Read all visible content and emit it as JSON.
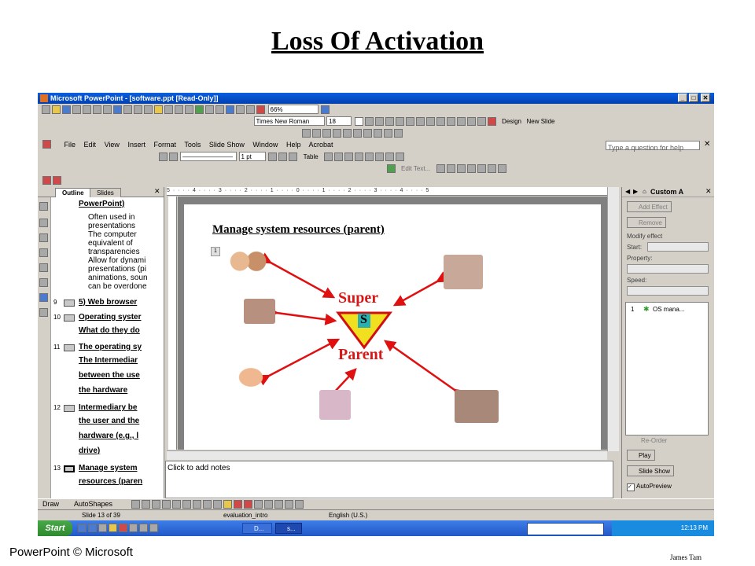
{
  "slide_title": "Loss Of Activation",
  "window": {
    "title": "Microsoft PowerPoint - [software.ppt [Read-Only]]"
  },
  "toolbar": {
    "zoom": "66%",
    "font": "Times New Roman",
    "font_size": "18",
    "design": "Design",
    "new_slide": "New Slide"
  },
  "menu": [
    "File",
    "Edit",
    "View",
    "Insert",
    "Format",
    "Tools",
    "Slide Show",
    "Window",
    "Help",
    "Acrobat"
  ],
  "help_box": "Type a question for help",
  "drawing_toolbar": {
    "line_weight": "1 pt",
    "table": "Table",
    "edit_text": "Edit Text..."
  },
  "outline": {
    "tabs": [
      "Outline",
      "Slides"
    ],
    "top_text": "PowerPoint)",
    "sub": [
      "Often used in",
      "presentations",
      "The computer",
      "equivalent of",
      "transparencies",
      "Allow for dynami",
      "presentations (pi",
      "animations, soun",
      "can be overdone"
    ],
    "slides": [
      {
        "num": "9",
        "lines": [
          "5) Web browser"
        ]
      },
      {
        "num": "10",
        "lines": [
          "Operating syster",
          "What do they do"
        ]
      },
      {
        "num": "11",
        "lines": [
          "The operating sy",
          "The Intermediar",
          "between the use",
          "the hardware"
        ]
      },
      {
        "num": "12",
        "lines": [
          "Intermediary be",
          "the user and the",
          "hardware (e.g., l",
          "drive)"
        ]
      },
      {
        "num": "13",
        "lines": [
          "Manage system",
          "resources (paren"
        ]
      }
    ]
  },
  "slide": {
    "heading": "Manage system resources (parent)",
    "marker": "1",
    "super": "Super",
    "s": "S",
    "parent": "Parent"
  },
  "notes_placeholder": "Click to add notes",
  "task_pane": {
    "title": "Custom A",
    "add_effect": "Add Effect",
    "remove": "Remove",
    "modify_effect": "Modify effect",
    "start": "Start:",
    "property": "Property:",
    "speed": "Speed:",
    "anim_item": "OS mana...",
    "anim_num": "1",
    "reorder": "Re-Order",
    "play": "Play",
    "slide_show": "Slide Show",
    "autopreview": "AutoPreview"
  },
  "draw_bar": {
    "draw": "Draw",
    "autoshapes": "AutoShapes"
  },
  "status": {
    "slide": "Slide 13 of 39",
    "design": "evaluation_intro",
    "language": "English (U.S.)"
  },
  "taskbar": {
    "start": "Start",
    "items": [
      "D...",
      "s..."
    ],
    "clock": "12:13 PM"
  },
  "footer": {
    "left": "PowerPoint © Microsoft",
    "right": "James Tam"
  },
  "colors": {
    "titlebar": "#0a5ee0",
    "arrow": "#e01010",
    "super_text": "#d81818",
    "triangle": "#f0e020"
  }
}
